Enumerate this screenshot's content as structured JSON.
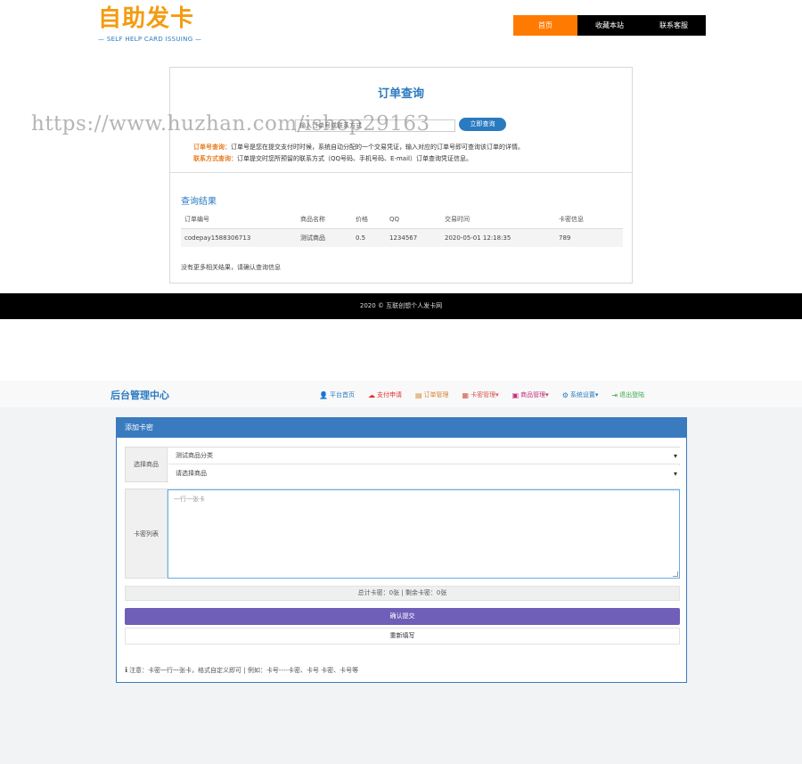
{
  "logo": {
    "text": "自助发卡",
    "sub": "— SELF HELP CARD ISSUING —"
  },
  "topnav": [
    {
      "label": "首页",
      "active": true
    },
    {
      "label": "收藏本站",
      "active": false
    },
    {
      "label": "联系客服",
      "active": false
    }
  ],
  "query": {
    "title": "订单查询",
    "input_value": "输入订单号或联系方式",
    "button": "立即查询",
    "tip1_key": "订单号查询：",
    "tip1_text": "订单号是您在提交支付时时候，系统自动分配的一个交易凭证，输入对应的订单号即可查询该订单的详情。",
    "tip2_key": "联系方式查询：",
    "tip2_text": "订单提交时您所预留的联系方式（QQ号码、手机号码、E-mail）订单查询凭证信息。",
    "watermark": "https://www.huzhan.com/ishop29163"
  },
  "result": {
    "title": "查询结果",
    "headers": [
      "订单编号",
      "商品名称",
      "价格",
      "QQ",
      "交易时间",
      "卡密信息"
    ],
    "row": [
      "codepay1588306713",
      "测试商品",
      "0.5",
      "1234567",
      "2020-05-01 12:18:35",
      "789"
    ],
    "no_more": "没有更多相关结果，请确认查询信息"
  },
  "footer": "2020 © 互联创想个人发卡网",
  "admin": {
    "brand": "后台管理中心",
    "nav": [
      {
        "icon": "user-icon",
        "glyph": "👤",
        "label": "平台首页"
      },
      {
        "icon": "cloud-icon",
        "glyph": "☁",
        "label": "支付申请"
      },
      {
        "icon": "order-icon",
        "glyph": "▤",
        "label": "订单管理"
      },
      {
        "icon": "card-icon",
        "glyph": "▦",
        "label": "卡密管理▾"
      },
      {
        "icon": "goods-icon",
        "glyph": "▣",
        "label": "商品管理▾"
      },
      {
        "icon": "gear-icon",
        "glyph": "⚙",
        "label": "系统设置▾"
      },
      {
        "icon": "logout-icon",
        "glyph": "⇥",
        "label": "退出登陆"
      }
    ],
    "panel_title": "添加卡密",
    "select_label": "选择商品",
    "category_value": "测试商品分类",
    "goods_value": "请选择商品",
    "list_label": "卡密列表",
    "textarea_placeholder": "一行一张卡",
    "count_text": "总计卡密：0张 | 剩余卡密：0张",
    "submit": "确认提交",
    "reset": "重新填写",
    "note": "注意：卡密一行一张卡，格式自定义即可 | 例如：卡号----卡密、卡号 卡密、卡号等"
  }
}
